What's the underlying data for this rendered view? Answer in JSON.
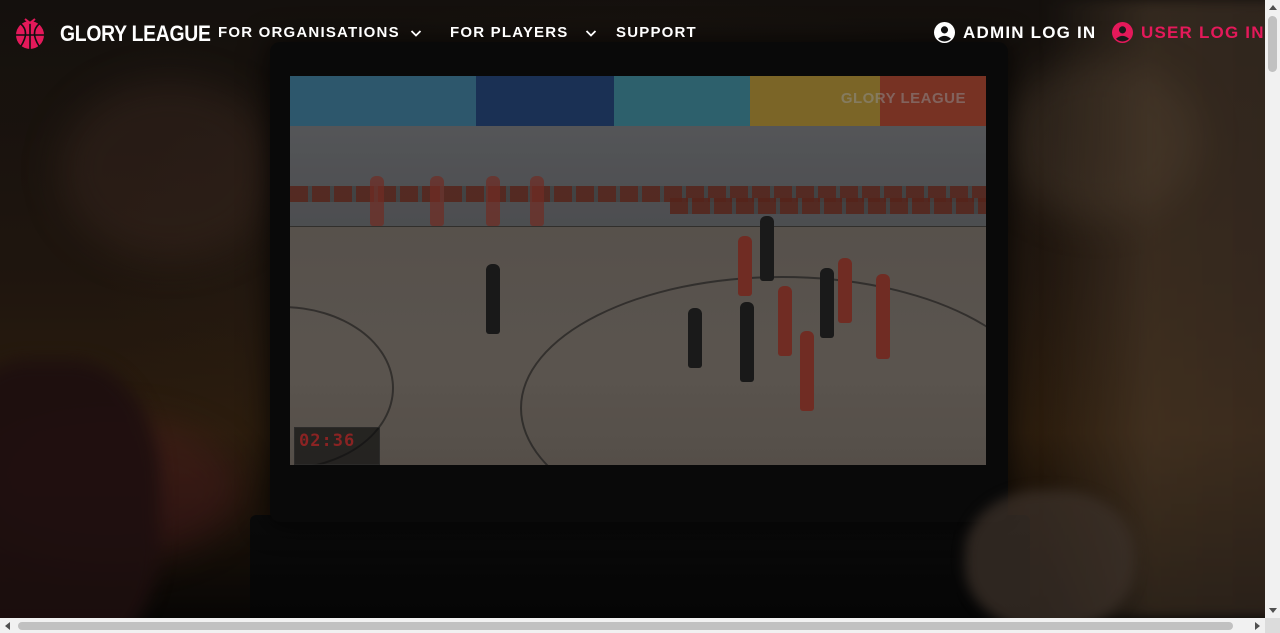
{
  "brand": {
    "name": "GLORY LEAGUE",
    "accent_color": "#e4195a",
    "logo_icon": "basketball-logo-icon"
  },
  "nav": {
    "items": [
      {
        "label": "FOR ORGANISATIONS",
        "icon": "chevron-down-icon"
      },
      {
        "label": "FOR PLAYERS",
        "icon": "chevron-down-icon"
      },
      {
        "label": "SUPPORT"
      }
    ],
    "admin_login": {
      "label": "ADMIN LOG IN",
      "icon": "user-circle-icon",
      "color": "#ffffff"
    },
    "user_login": {
      "label": "USER LOG IN",
      "icon": "user-circle-icon",
      "color": "#e4195a"
    }
  },
  "hero": {
    "image": "laptop-showing-basketball-game-video",
    "video_overlay": {
      "watermark": "GLORY LEAGUE",
      "scoreboard_time": "02:36"
    }
  }
}
